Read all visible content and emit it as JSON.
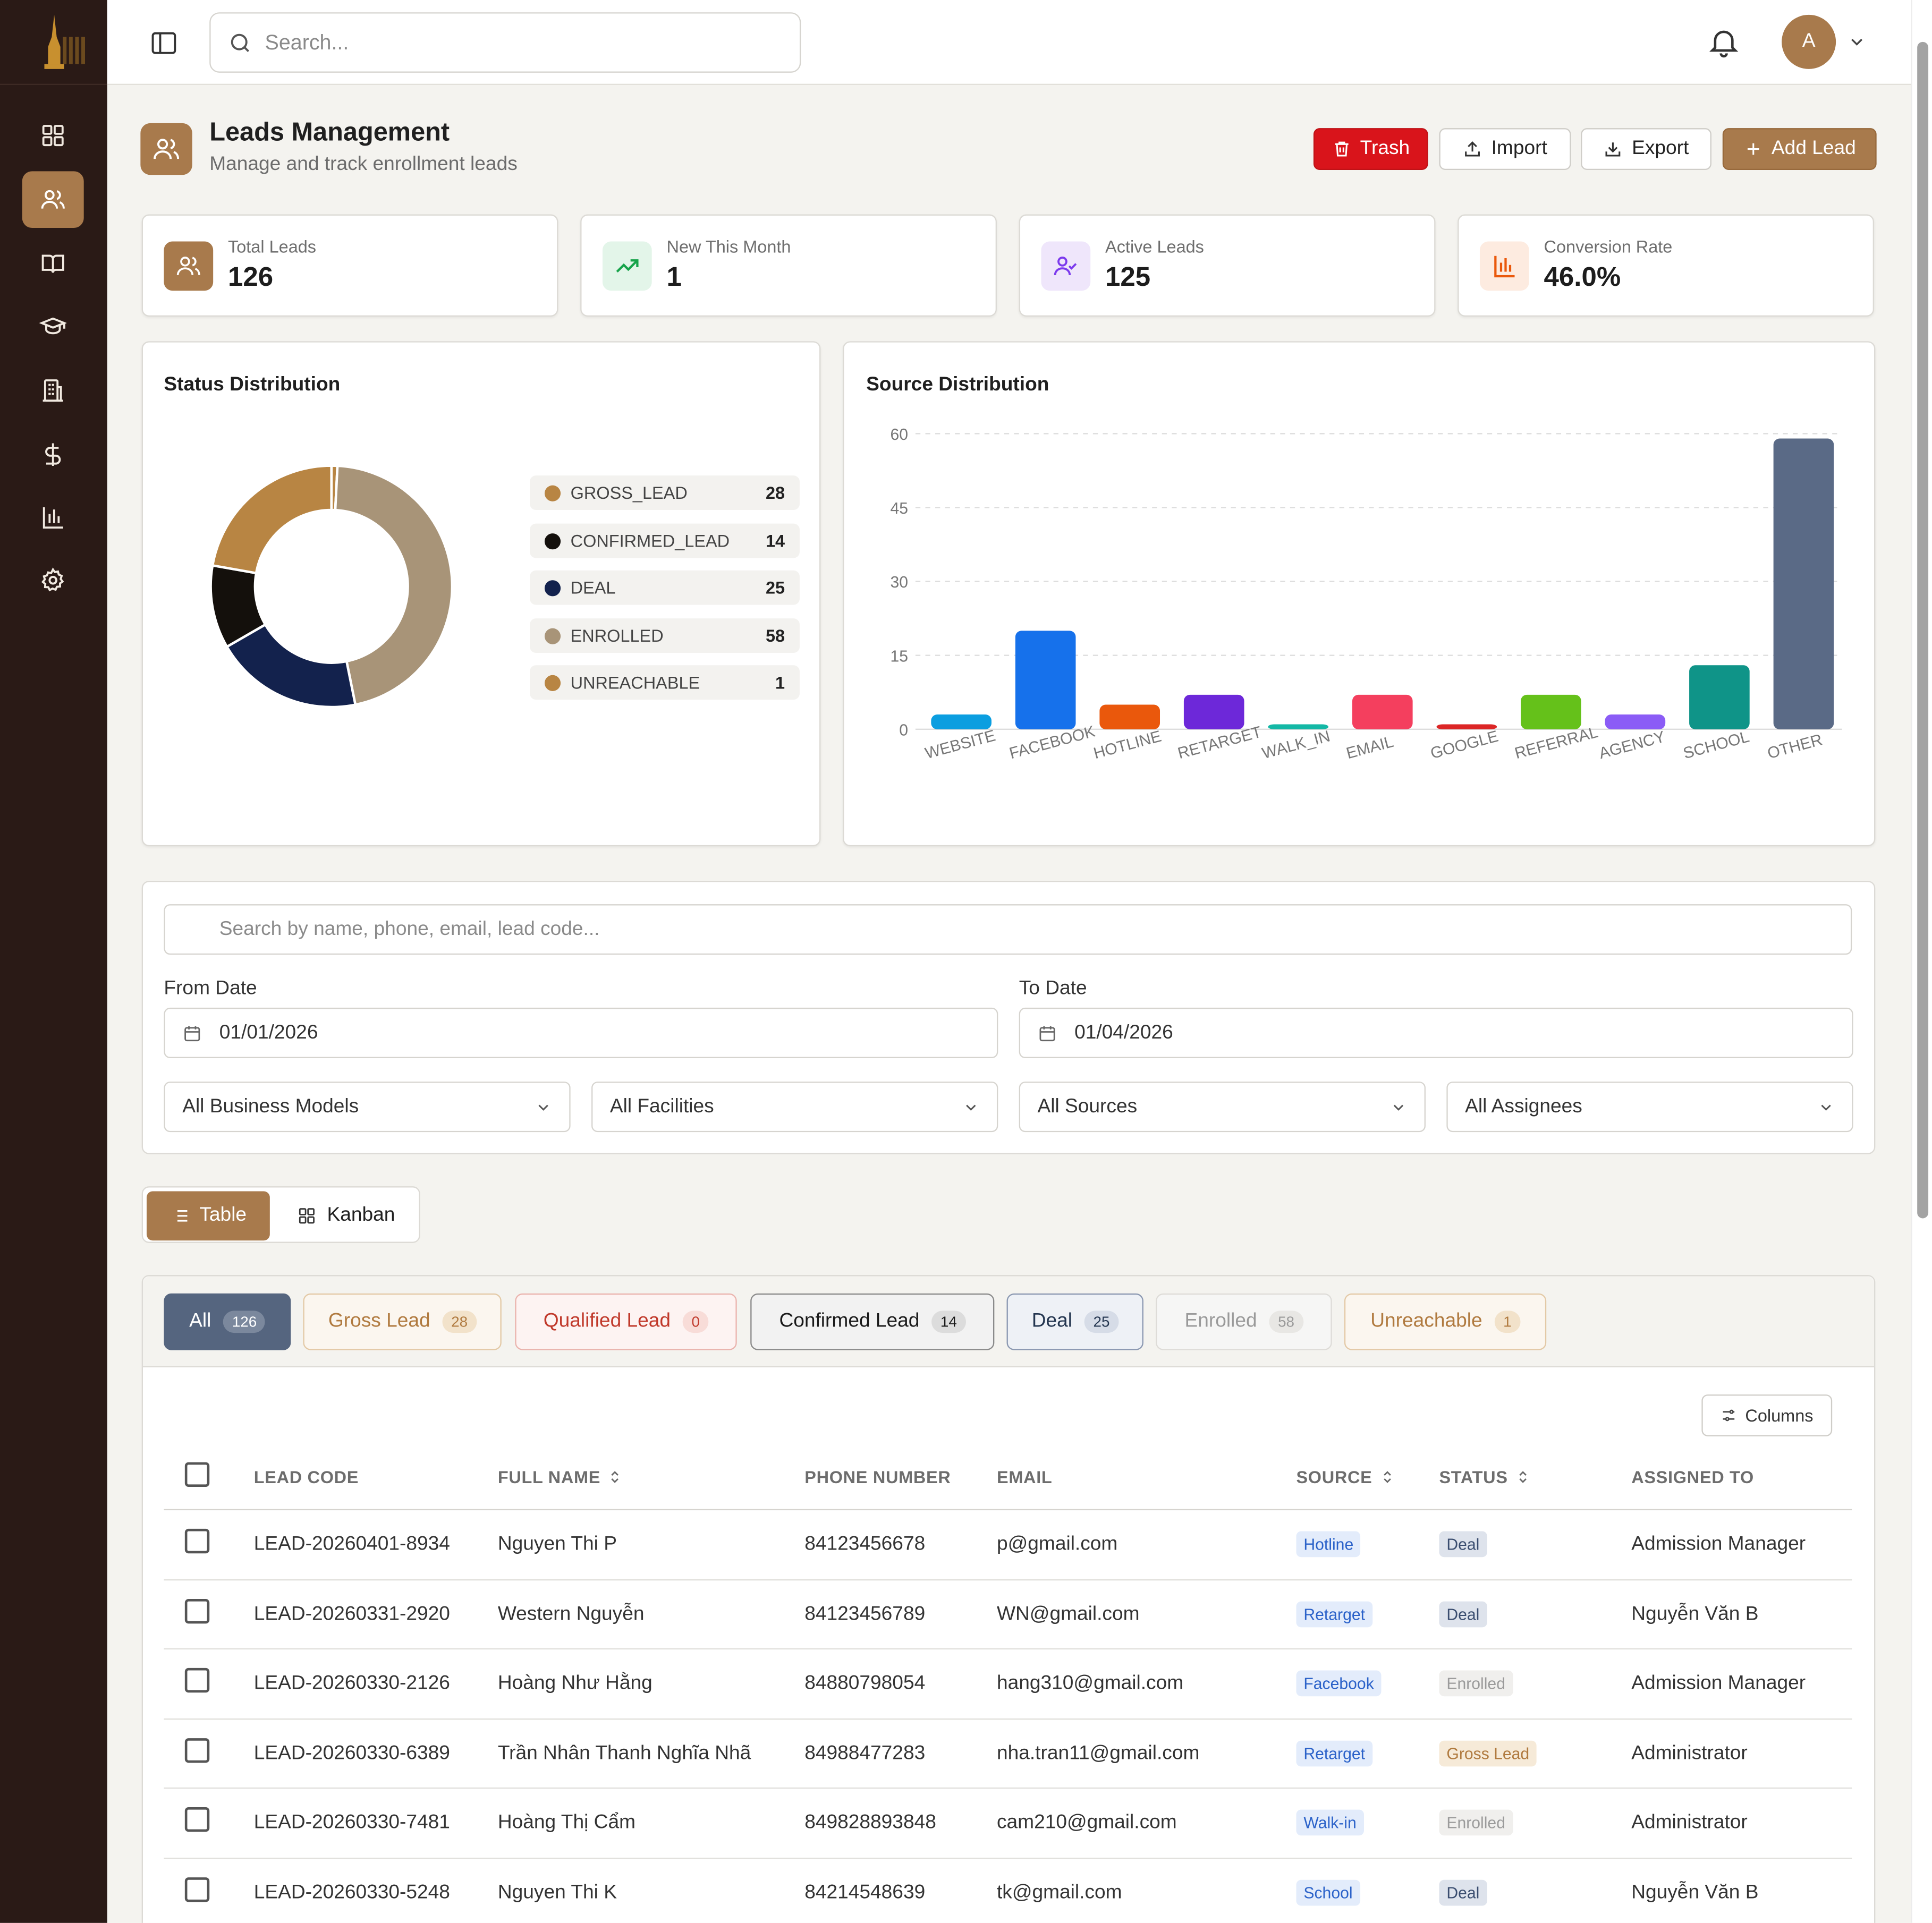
{
  "topbar": {
    "search_placeholder": "Search...",
    "avatar_initial": "A"
  },
  "sidebar": {
    "items": [
      {
        "icon": "dashboard-icon",
        "active": false
      },
      {
        "icon": "users-icon",
        "active": true
      },
      {
        "icon": "book-icon",
        "active": false
      },
      {
        "icon": "graduation-cap-icon",
        "active": false
      },
      {
        "icon": "building-icon",
        "active": false
      },
      {
        "icon": "dollar-icon",
        "active": false
      },
      {
        "icon": "bar-chart-icon",
        "active": false
      },
      {
        "icon": "settings-icon",
        "active": false
      }
    ]
  },
  "header": {
    "title": "Leads Management",
    "subtitle": "Manage and track enrollment leads",
    "trash_label": "Trash",
    "import_label": "Import",
    "export_label": "Export",
    "add_label": "Add Lead"
  },
  "stats": [
    {
      "label": "Total Leads",
      "value": "126"
    },
    {
      "label": "New This Month",
      "value": "1"
    },
    {
      "label": "Active Leads",
      "value": "125"
    },
    {
      "label": "Conversion Rate",
      "value": "46.0%"
    }
  ],
  "status_chart": {
    "title": "Status Distribution"
  },
  "source_chart": {
    "title": "Source Distribution"
  },
  "chart_data": [
    {
      "type": "pie",
      "title": "Status Distribution",
      "categories": [
        "GROSS_LEAD",
        "CONFIRMED_LEAD",
        "DEAL",
        "ENROLLED",
        "UNREACHABLE"
      ],
      "values": [
        28,
        14,
        25,
        58,
        1
      ],
      "colors": [
        "#b88543",
        "#14100c",
        "#13224d",
        "#a89478",
        "#b88543"
      ],
      "legend": "right"
    },
    {
      "type": "bar",
      "title": "Source Distribution",
      "categories": [
        "WEBSITE",
        "FACEBOOK",
        "HOTLINE",
        "RETARGET",
        "WALK_IN",
        "EMAIL",
        "GOOGLE",
        "REFERRAL",
        "AGENCY",
        "SCHOOL",
        "OTHER"
      ],
      "values": [
        3,
        20,
        5,
        7,
        1,
        7,
        1,
        7,
        3,
        13,
        59
      ],
      "colors": [
        "#0b9ee0",
        "#1671eb",
        "#ea580c",
        "#6d28d9",
        "#14b8a6",
        "#f43f5e",
        "#dc2626",
        "#65c11a",
        "#8b5cf6",
        "#0f9488",
        "#5a6a86"
      ],
      "ylim": [
        0,
        60
      ],
      "yticks": [
        0,
        15,
        30,
        45,
        60
      ],
      "grid": true
    }
  ],
  "filters": {
    "search_placeholder": "Search by name, phone, email, lead code...",
    "from_label": "From Date",
    "from_value": "01/01/2026",
    "to_label": "To Date",
    "to_value": "01/04/2026",
    "business_model": "All Business Models",
    "facilities": "All Facilities",
    "sources": "All Sources",
    "assignees": "All Assignees"
  },
  "view": {
    "table_label": "Table",
    "kanban_label": "Kanban"
  },
  "tabs": [
    {
      "label": "All",
      "count": "126"
    },
    {
      "label": "Gross Lead",
      "count": "28"
    },
    {
      "label": "Qualified Lead",
      "count": "0"
    },
    {
      "label": "Confirmed Lead",
      "count": "14"
    },
    {
      "label": "Deal",
      "count": "25"
    },
    {
      "label": "Enrolled",
      "count": "58"
    },
    {
      "label": "Unreachable",
      "count": "1"
    }
  ],
  "table": {
    "columns_label": "Columns",
    "headers": [
      "LEAD CODE",
      "FULL NAME",
      "PHONE NUMBER",
      "EMAIL",
      "SOURCE",
      "STATUS",
      "ASSIGNED TO"
    ],
    "rows": [
      {
        "code": "LEAD-20260401-8934",
        "name": "Nguyen Thi P",
        "phone": "84123456678",
        "email": "p@gmail.com",
        "source": "Hotline",
        "status": "Deal",
        "assigned": "Admission Manager"
      },
      {
        "code": "LEAD-20260331-2920",
        "name": "Western Nguyễn",
        "phone": "84123456789",
        "email": "WN@gmail.com",
        "source": "Retarget",
        "status": "Deal",
        "assigned": "Nguyễn Văn B"
      },
      {
        "code": "LEAD-20260330-2126",
        "name": "Hoàng Như Hằng",
        "phone": "84880798054",
        "email": "hang310@gmail.com",
        "source": "Facebook",
        "status": "Enrolled",
        "assigned": "Admission Manager"
      },
      {
        "code": "LEAD-20260330-6389",
        "name": "Trần Nhân Thanh Nghĩa Nhã",
        "phone": "84988477283",
        "email": "nha.tran11@gmail.com",
        "source": "Retarget",
        "status": "Gross Lead",
        "assigned": "Administrator"
      },
      {
        "code": "LEAD-20260330-7481",
        "name": "Hoàng Thị Cẩm",
        "phone": "849828893848",
        "email": "cam210@gmail.com",
        "source": "Walk-in",
        "status": "Enrolled",
        "assigned": "Administrator"
      },
      {
        "code": "LEAD-20260330-5248",
        "name": "Nguyen Thi K",
        "phone": "84214548639",
        "email": "tk@gmail.com",
        "source": "School",
        "status": "Deal",
        "assigned": "Nguyễn Văn B"
      }
    ]
  }
}
